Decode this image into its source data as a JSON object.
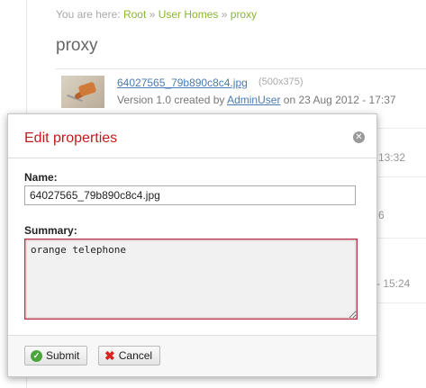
{
  "breadcrumb": {
    "prefix": "You are here:",
    "items": [
      "Root",
      "User Homes",
      "proxy"
    ],
    "separator": "»"
  },
  "folder": {
    "title": "proxy"
  },
  "file": {
    "name": "64027565_79b890c8c4.jpg",
    "dims": "(500x375)",
    "meta_prefix": "Version 1.0 created by",
    "user": "AdminUser",
    "meta_suffix": "on 23 Aug 2012 - 17:37"
  },
  "background_rows": [
    {
      "text": "13:32"
    },
    {
      "text": "6"
    },
    {
      "text": "- 15:24"
    }
  ],
  "dialog": {
    "title": "Edit properties",
    "close_icon": "close-circle-icon",
    "name_label": "Name:",
    "name_value": "64027565_79b890c8c4.jpg",
    "summary_label": "Summary:",
    "summary_value": "orange telephone",
    "submit_label": "Submit",
    "cancel_label": "Cancel"
  },
  "colors": {
    "accent_title": "#c01c1c",
    "breadcrumb_link": "#8ab62f",
    "link": "#4a7bb3",
    "summary_border": "#b03540"
  }
}
